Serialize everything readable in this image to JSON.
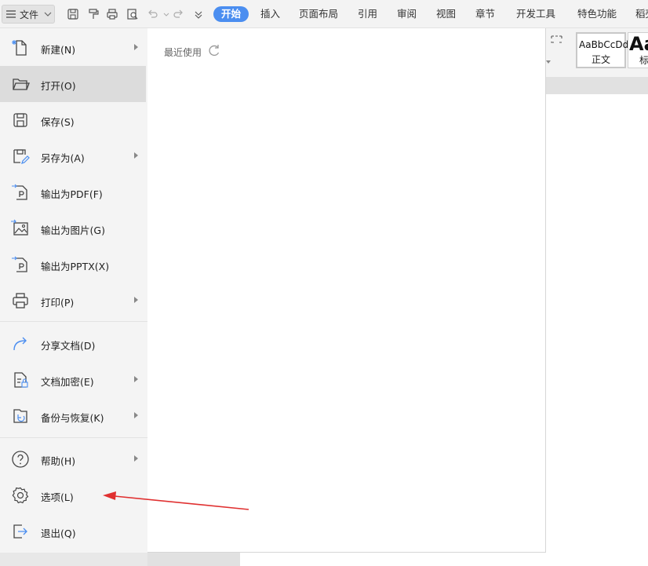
{
  "menubar": {
    "file_label": "文件",
    "tabs": [
      "开始",
      "插入",
      "页面布局",
      "引用",
      "审阅",
      "视图",
      "章节",
      "开发工具",
      "特色功能",
      "稻壳"
    ],
    "active_tab": "开始",
    "accent_color": "#4b8ef0"
  },
  "quick_access": [
    "save-icon",
    "format-painter-icon",
    "print-icon",
    "print-preview-icon",
    "undo-icon",
    "redo-icon",
    "customize-icon"
  ],
  "file_menu": {
    "items": [
      {
        "label": "新建(N)",
        "icon": "new-doc-icon",
        "submenu": true
      },
      {
        "label": "打开(O)",
        "icon": "folder-open-icon",
        "submenu": false
      },
      {
        "label": "保存(S)",
        "icon": "save-icon",
        "submenu": false
      },
      {
        "label": "另存为(A)",
        "icon": "save-as-icon",
        "submenu": true
      },
      {
        "label": "输出为PDF(F)",
        "icon": "export-pdf-icon",
        "submenu": false
      },
      {
        "label": "输出为图片(G)",
        "icon": "export-image-icon",
        "submenu": false
      },
      {
        "label": "输出为PPTX(X)",
        "icon": "export-pptx-icon",
        "submenu": false
      },
      {
        "label": "打印(P)",
        "icon": "print-icon",
        "submenu": true
      },
      {
        "label": "分享文档(D)",
        "icon": "share-icon",
        "submenu": false
      },
      {
        "label": "文档加密(E)",
        "icon": "encrypt-icon",
        "submenu": true
      },
      {
        "label": "备份与恢复(K)",
        "icon": "backup-icon",
        "submenu": true
      },
      {
        "label": "帮助(H)",
        "icon": "help-icon",
        "submenu": true
      },
      {
        "label": "选项(L)",
        "icon": "gear-icon",
        "submenu": false
      },
      {
        "label": "退出(Q)",
        "icon": "exit-icon",
        "submenu": false
      }
    ]
  },
  "recent": {
    "title": "最近使用"
  },
  "styles": {
    "sample1": "AaBbCcDd",
    "name1": "正文",
    "sample2": "Aa",
    "name2": "标"
  },
  "annotation_color": "#e03030"
}
